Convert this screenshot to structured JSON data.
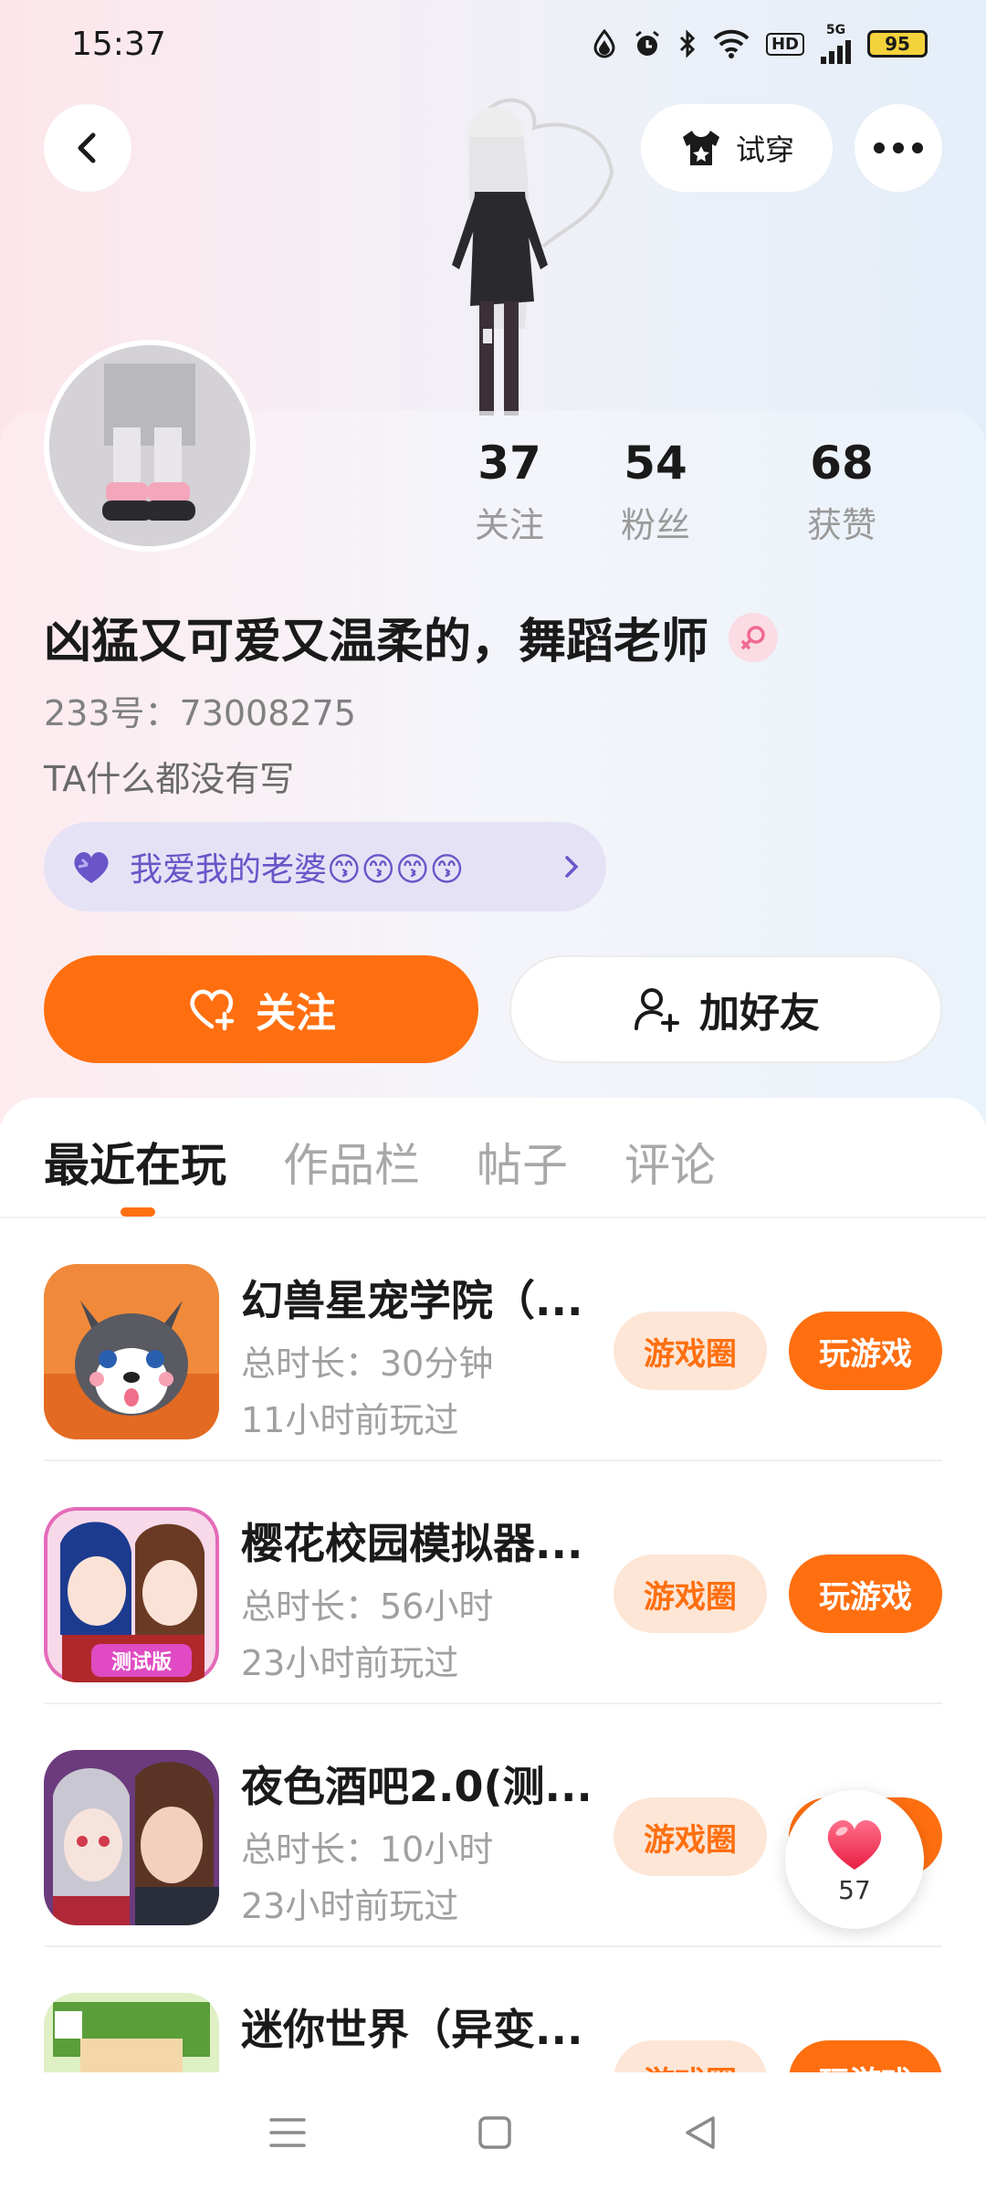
{
  "status_bar": {
    "time": "15:37",
    "battery": "95",
    "network": "5G",
    "hd": "HD"
  },
  "header": {
    "tryon_label": "试穿"
  },
  "profile": {
    "stats": [
      {
        "value": "37",
        "label": "关注"
      },
      {
        "value": "54",
        "label": "粉丝"
      },
      {
        "value": "68",
        "label": "获赞"
      }
    ],
    "nickname": "凶猛又可爱又温柔的，舞蹈老师",
    "uid": "233号：73008275",
    "bio": "TA什么都没有写",
    "tag_text": "我爱我的老婆😙😙😙😙",
    "follow_label": "关注",
    "add_friend_label": "加好友"
  },
  "tabs": [
    {
      "label": "最近在玩",
      "active": true
    },
    {
      "label": "作品栏",
      "active": false
    },
    {
      "label": "帖子",
      "active": false
    },
    {
      "label": "评论",
      "active": false
    }
  ],
  "games": [
    {
      "title": "幻兽星宠学院（...",
      "duration": "总时长：30分钟",
      "last_played": "11小时前玩过",
      "circle_label": "游戏圈",
      "play_label": "玩游戏"
    },
    {
      "title": "樱花校园模拟器...",
      "duration": "总时长：56小时",
      "last_played": "23小时前玩过",
      "circle_label": "游戏圈",
      "play_label": "玩游戏",
      "icon_badge": "测试版"
    },
    {
      "title": "夜色酒吧2.0(测...",
      "duration": "总时长：10小时",
      "last_played": "23小时前玩过",
      "circle_label": "游戏圈",
      "play_label": "玩游戏"
    },
    {
      "title": "迷你世界（异变...",
      "duration": "",
      "last_played": "",
      "circle_label": "游戏圈",
      "play_label": "玩游戏"
    }
  ],
  "like_fab": {
    "count": "57"
  },
  "colors": {
    "accent": "#ff6f10",
    "tag_bg": "#e6e2f6",
    "tag_text": "#6a55c8"
  },
  "icons": [
    "back-arrow-icon",
    "tshirt-icon",
    "more-dots-icon",
    "heart-plus-icon",
    "add-person-icon",
    "purple-heart-icon",
    "chevron-right-icon",
    "female-gender-icon",
    "heart-icon",
    "menu-icon",
    "home-square-icon",
    "back-triangle-icon"
  ]
}
